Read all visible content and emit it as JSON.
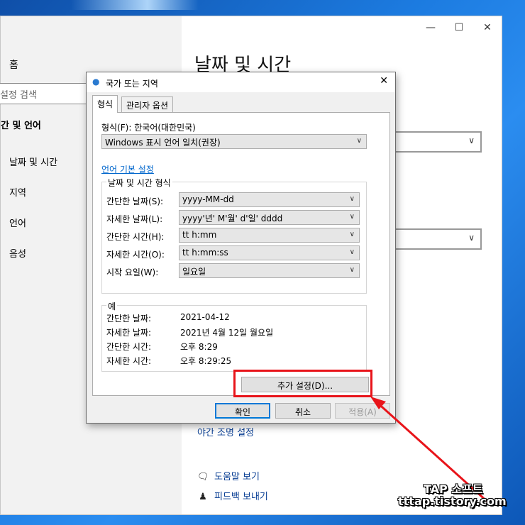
{
  "settings": {
    "sidebar": {
      "home": "홈",
      "search_placeholder": "설정 검색",
      "heading": "간 및 언어",
      "items": [
        "날짜 및 시간",
        "지역",
        "언어",
        "음성"
      ]
    },
    "title": "날짜 및 시간",
    "night_light_link": "야간 조명 설정",
    "help_link": "도움말 보기",
    "feedback_link": "피드백 보내기",
    "window_controls": {
      "minimize": "—",
      "maximize": "☐",
      "close": "✕"
    }
  },
  "dialog": {
    "title": "국가 또는 지역",
    "close": "✕",
    "tabs": [
      {
        "label": "형식",
        "active": true
      },
      {
        "label": "관리자 옵션",
        "active": false
      }
    ],
    "format_label": "형식(F): 한국어(대한민국)",
    "format_value": "Windows 표시 언어 일치(권장)",
    "language_link": "언어 기본 설정",
    "datetime_group": {
      "title": "날짜 및 시간 형식",
      "rows": [
        {
          "label": "간단한 날짜(S):",
          "value": "yyyy-MM-dd"
        },
        {
          "label": "자세한 날짜(L):",
          "value": "yyyy'년' M'월' d'일' dddd"
        },
        {
          "label": "간단한 시간(H):",
          "value": "tt h:mm"
        },
        {
          "label": "자세한 시간(O):",
          "value": "tt h:mm:ss"
        },
        {
          "label": "시작 요일(W):",
          "value": "일요일"
        }
      ]
    },
    "example_group": {
      "title": "예",
      "rows": [
        {
          "label": "간단한 날짜:",
          "value": "2021-04-12"
        },
        {
          "label": "자세한 날짜:",
          "value": "2021년 4월 12일 월요일"
        },
        {
          "label": "간단한 시간:",
          "value": "오후 8:29"
        },
        {
          "label": "자세한 시간:",
          "value": "오후 8:29:25"
        }
      ]
    },
    "additional_settings": "추가 설정(D)...",
    "ok": "확인",
    "cancel": "취소",
    "apply": "적용(A)"
  },
  "watermark": {
    "line1": "TAP 소프트",
    "line2": "tttap.tistory.com"
  },
  "colors": {
    "highlight": "#e8141a",
    "link": "#0066cc",
    "accent": "#0078d7"
  }
}
